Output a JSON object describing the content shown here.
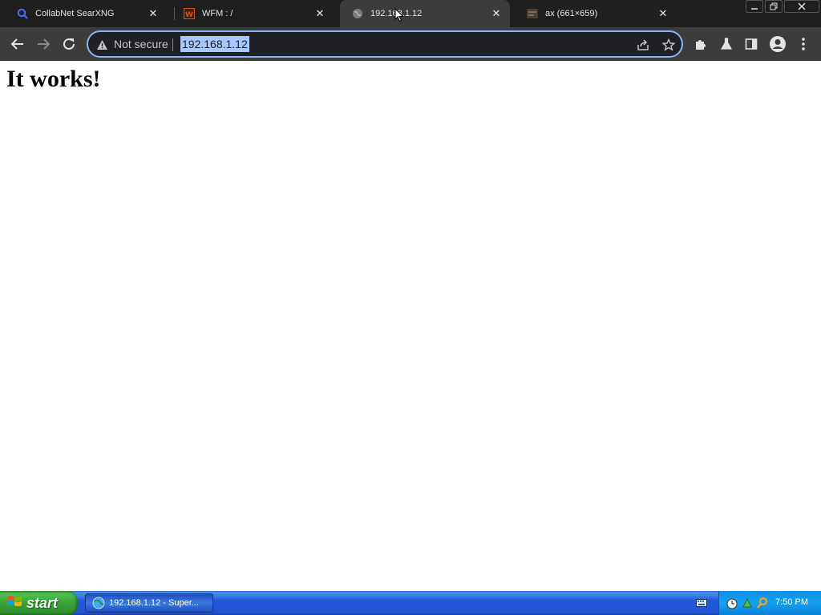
{
  "tabs": [
    {
      "title": "CollabNet SearXNG",
      "favicon": "search-icon",
      "active": false
    },
    {
      "title": "WFM : /",
      "favicon": "wfm-icon",
      "active": false
    },
    {
      "title": "192.168.1.12",
      "favicon": "globe-icon",
      "active": true
    },
    {
      "title": "ax (661×659)",
      "favicon": "image-icon",
      "active": false
    }
  ],
  "omnibox": {
    "security_label": "Not secure",
    "url": "192.168.1.12"
  },
  "page": {
    "heading": "It works!"
  },
  "taskbar": {
    "start_label": "start",
    "task_item": "192.168.1.12 - Super...",
    "clock": "7:50 PM"
  },
  "colors": {
    "tab_strip": "#1f1f1f",
    "toolbar": "#3c3c3c",
    "omnibox_focus": "#8ab4f8",
    "url_selection": "#a8c7fa",
    "taskbar_blue": "#2157d7",
    "start_green": "#37a337"
  }
}
